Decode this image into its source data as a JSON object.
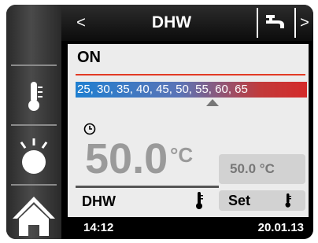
{
  "header": {
    "title": "DHW",
    "back_glyph": "<",
    "next_glyph": ">",
    "tap_icon": "tap-icon"
  },
  "main": {
    "status": "ON",
    "scale_text": "25, 30, 35, 40, 45, 50, 55, 60, 65",
    "current_temp": "50.0",
    "current_unit": "°C",
    "mode_label": "DHW",
    "setpoint_value": "50.0 °C",
    "set_button_label": "Set"
  },
  "footer": {
    "time": "14:12",
    "date": "20.01.13"
  },
  "sidebar": {
    "items": [
      {
        "icon": "thermometer-icon"
      },
      {
        "icon": "sun-icon"
      },
      {
        "icon": "home-icon"
      }
    ]
  },
  "colors": {
    "scale_start": "#1f7fd0",
    "scale_end": "#d42a2a",
    "accent_red": "#e23a24",
    "panel_bg": "#ececec"
  }
}
